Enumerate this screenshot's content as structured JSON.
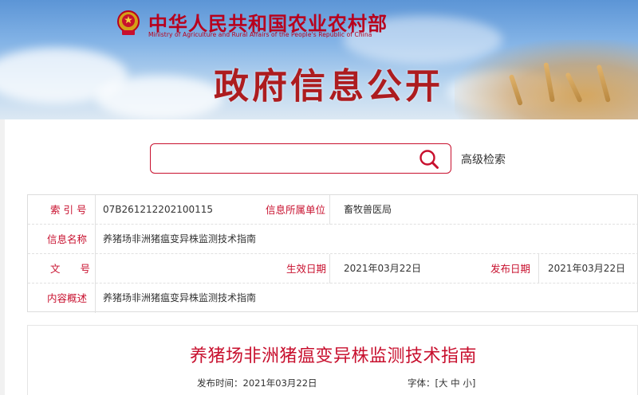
{
  "header": {
    "site_title": "中华人民共和国农业农村部",
    "site_subtitle": "Ministry of Agriculture and Rural Affairs of the People's Republic of China",
    "section_title": "政府信息公开"
  },
  "search": {
    "value": "",
    "advanced_label": "高级检索"
  },
  "info": {
    "index_label": "索 引 号",
    "index_value": "07B261212202100115",
    "org_label": "信息所属单位",
    "org_value": "畜牧兽医局",
    "name_label": "信息名称",
    "name_value": "养猪场非洲猪瘟变异株监测技术指南",
    "doc_label": "文　　号",
    "doc_value": "",
    "effective_label": "生效日期",
    "effective_value": "2021年03月22日",
    "publish_label": "发布日期",
    "publish_value": "2021年03月22日",
    "summary_label": "内容概述",
    "summary_value": "养猪场非洲猪瘟变异株监测技术指南"
  },
  "article": {
    "title": "养猪场非洲猪瘟变异株监测技术指南",
    "publish_time_label": "发布时间：",
    "publish_time_value": "2021年03月22日",
    "font_label": "字体：",
    "font_open": "[",
    "font_large": "大",
    "font_medium": "中",
    "font_small": "小",
    "font_close": "]"
  },
  "colors": {
    "brand_red": "#c8102e",
    "banner_blue": "#5c95d6"
  },
  "icons": [
    "national-emblem-icon",
    "search-icon"
  ]
}
